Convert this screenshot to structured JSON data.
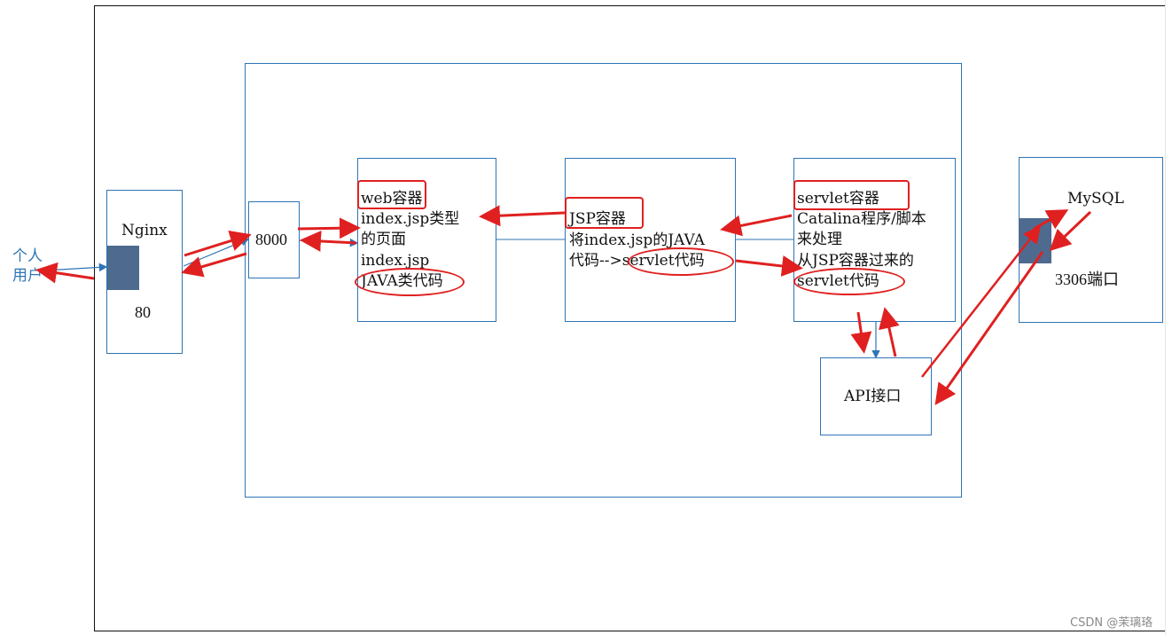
{
  "user": {
    "label_line1": "个人",
    "label_line2": "用户"
  },
  "nginx": {
    "title": "Nginx",
    "port": "80"
  },
  "container": {
    "port": "8000"
  },
  "web_container": {
    "title": "web容器",
    "line2": "index.jsp类型",
    "line3": "的页面",
    "line4": "index.jsp",
    "line5": "JAVA类代码"
  },
  "jsp_container": {
    "title": "JSP容器",
    "line2": "将index.jsp的JAVA",
    "line3_prefix": "代码-->",
    "line3_highlight": "servlet代码"
  },
  "servlet_container": {
    "title": "servlet容器",
    "line2": "Catalina程序/脚本",
    "line3": "来处理",
    "line4": "从JSP容器过来的",
    "line5": "servlet代码"
  },
  "api": {
    "label": "API接口"
  },
  "mysql": {
    "title": "MySQL",
    "port": "3306端口"
  },
  "watermark": "CSDN @茉璃珞",
  "colors": {
    "box_border": "#2e75b6",
    "arrow": "#e02020",
    "port_block": "#4e6b8f"
  }
}
